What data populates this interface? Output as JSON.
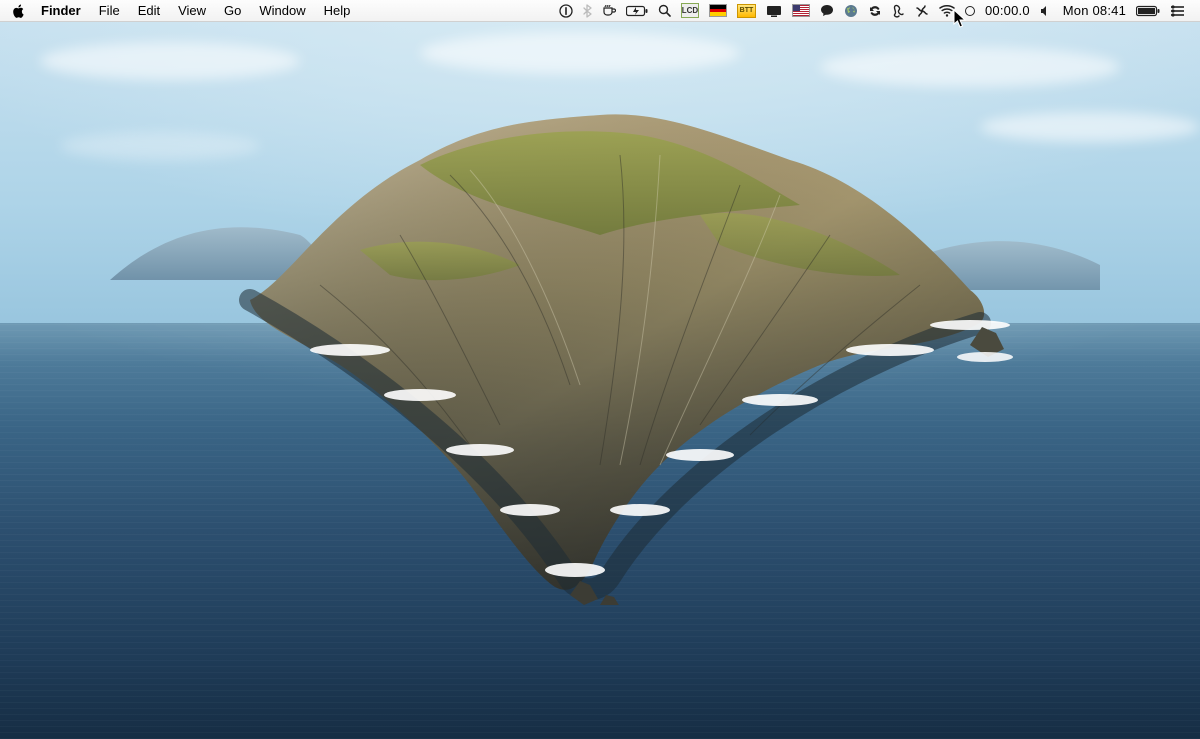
{
  "menubar": {
    "app_name": "Finder",
    "items": [
      {
        "label": "File"
      },
      {
        "label": "Edit"
      },
      {
        "label": "View"
      },
      {
        "label": "Go"
      },
      {
        "label": "Window"
      },
      {
        "label": "Help"
      }
    ],
    "status": {
      "lcd_badge": "LCD",
      "btt_badge": "BTT",
      "timer": "00:00.0",
      "clock": "Mon 08:41"
    }
  }
}
